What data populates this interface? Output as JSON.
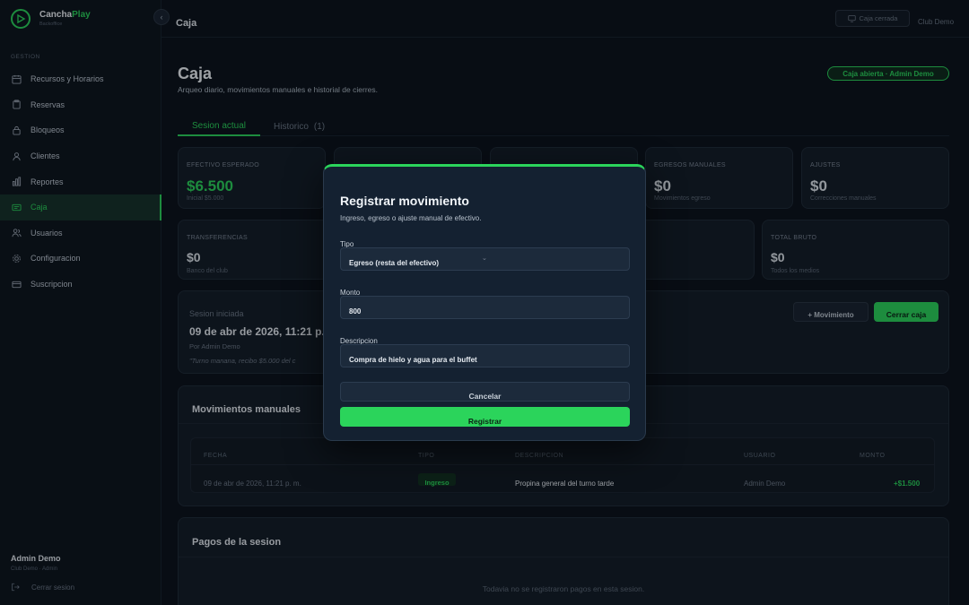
{
  "brand": {
    "name_main": "Cancha",
    "name_accent": "Play",
    "sub": "Backoffice"
  },
  "sidebar": {
    "section": "GESTION",
    "items": [
      {
        "label": "Recursos y Horarios",
        "icon": "calendar-icon"
      },
      {
        "label": "Reservas",
        "icon": "clipboard-icon"
      },
      {
        "label": "Bloqueos",
        "icon": "lock-icon"
      },
      {
        "label": "Clientes",
        "icon": "users-icon"
      },
      {
        "label": "Reportes",
        "icon": "bar-chart-icon"
      },
      {
        "label": "Caja",
        "icon": "cash-icon",
        "active": true
      },
      {
        "label": "Usuarios",
        "icon": "user-group-icon"
      },
      {
        "label": "Configuracion",
        "icon": "gear-icon"
      },
      {
        "label": "Suscripcion",
        "icon": "credit-card-icon"
      }
    ],
    "user": {
      "name": "Admin Demo",
      "role": "Club Demo · Admin"
    },
    "logout": "Cerrar sesion"
  },
  "topbar": {
    "title": "Caja",
    "status": "Caja cerrada",
    "club": "Club Demo"
  },
  "page": {
    "title": "Caja",
    "subtitle": "Arqueo diario, movimientos manuales e historial de cierres.",
    "badge": "Caja abierta · Admin Demo"
  },
  "tabs": [
    {
      "label": "Sesion actual",
      "active": true
    },
    {
      "label": "Historico",
      "count": "(1)"
    }
  ],
  "stats": {
    "efectivo": {
      "label": "EFECTIVO ESPERADO",
      "value": "$6.500",
      "sub": "Inicial $5.000"
    },
    "egresos": {
      "label": "EGRESOS MANUALES",
      "value": "$0",
      "sub": "Movimientos egreso"
    },
    "ajustes": {
      "label": "AJUSTES",
      "value": "$0",
      "sub": "Correcciones manuales"
    },
    "transferencias": {
      "label": "TRANSFERENCIAS",
      "value": "$0",
      "sub": "Banco del club"
    },
    "total": {
      "label": "TOTAL BRUTO",
      "value": "$0",
      "sub": "Todos los medios"
    }
  },
  "session": {
    "label": "Sesion iniciada",
    "date": "09 de abr de 2026, 11:21 p.",
    "by": "Por Admin Demo",
    "note": "\"Turno manana, recibo $5.000 del c",
    "btn_movement": "+ Movimiento",
    "btn_close": "Cerrar caja"
  },
  "movements": {
    "title": "Movimientos manuales",
    "headers": [
      "FECHA",
      "TIPO",
      "DESCRIPCION",
      "USUARIO",
      "MONTO"
    ],
    "rows": [
      {
        "fecha": "09 de abr de 2026, 11:21 p. m.",
        "tipo": "Ingreso",
        "descripcion": "Propina general del turno tarde",
        "usuario": "Admin Demo",
        "monto": "+$1.500"
      }
    ]
  },
  "payments": {
    "title": "Pagos de la sesion",
    "empty": "Todavia no se registraron pagos en esta sesion."
  },
  "modal": {
    "title": "Registrar movimiento",
    "subtitle": "Ingreso, egreso o ajuste manual de efectivo.",
    "tipo_label": "Tipo",
    "tipo_value": "Egreso (resta del efectivo)",
    "monto_label": "Monto",
    "monto_value": "800",
    "descripcion_label": "Descripcion",
    "descripcion_value": "Compra de hielo y agua para el buffet",
    "cancel": "Cancelar",
    "submit": "Registrar"
  },
  "colors": {
    "accent": "#2bd45b",
    "background": "#0b121b",
    "card": "#131c27"
  }
}
